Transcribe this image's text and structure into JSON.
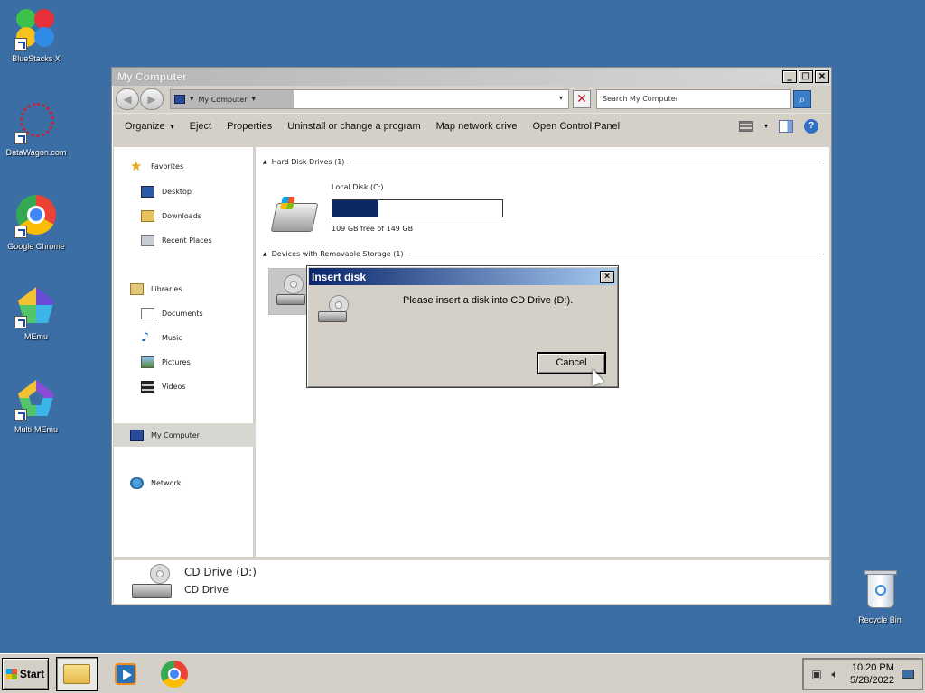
{
  "desktop": {
    "icons": [
      {
        "label": "BlueStacks X",
        "icon": "bluestacks-icon"
      },
      {
        "label": "DataWagon.com",
        "icon": "datawagon-icon"
      },
      {
        "label": "Google Chrome",
        "icon": "chrome-icon"
      },
      {
        "label": "MEmu",
        "icon": "memu-icon"
      },
      {
        "label": "Multi-MEmu",
        "icon": "multi-memu-icon"
      },
      {
        "label": "Recycle Bin",
        "icon": "recycle-bin-icon"
      }
    ]
  },
  "window": {
    "title": "My Computer",
    "controls": {
      "minimize": "_",
      "maximize": "□",
      "close": "×"
    },
    "address": {
      "crumb": "My Computer",
      "crumb_caret": "▾",
      "dropdown": "▾"
    },
    "search": {
      "placeholder": "Search My Computer"
    },
    "commands": {
      "organize": "Organize",
      "organize_caret": "▾",
      "eject": "Eject",
      "properties": "Properties",
      "uninstall": "Uninstall or change a program",
      "map_drive": "Map network drive",
      "control_panel": "Open Control Panel",
      "views_caret": "▾",
      "help": "?"
    },
    "nav": {
      "favorites": "Favorites",
      "desktop": "Desktop",
      "downloads": "Downloads",
      "recent": "Recent Places",
      "libraries": "Libraries",
      "documents": "Documents",
      "music": "Music",
      "pictures": "Pictures",
      "videos": "Videos",
      "computer": "My Computer",
      "network": "Network"
    },
    "groups": {
      "hdd": "Hard Disk Drives (1)",
      "removable": "Devices with Removable Storage (1)"
    },
    "local_disk": {
      "name": "Local Disk (C:)",
      "free_text": "109 GB free of 149 GB",
      "used_fraction": 0.27
    },
    "details": {
      "name": "CD Drive (D:)",
      "type": "CD Drive"
    }
  },
  "dialog": {
    "title": "Insert disk",
    "close": "×",
    "message": "Please insert a disk into CD Drive (D:).",
    "cancel": "Cancel"
  },
  "taskbar": {
    "start": "Start",
    "time": "10:20 PM",
    "date": "5/28/2022"
  }
}
